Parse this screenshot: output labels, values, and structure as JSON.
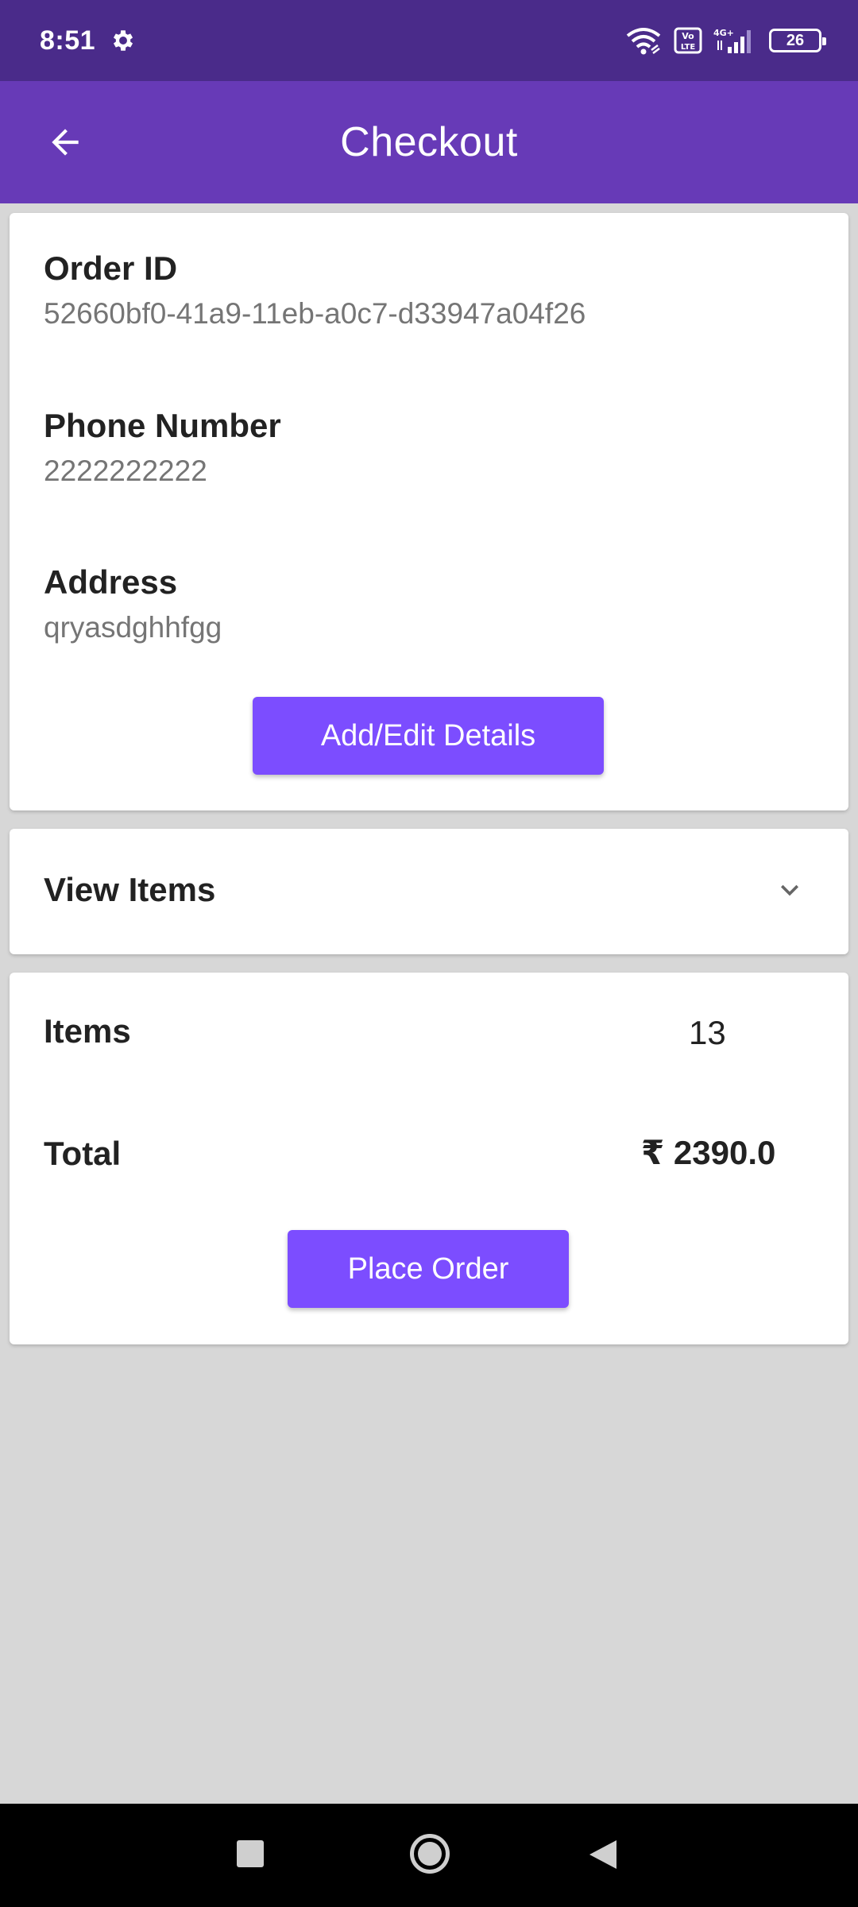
{
  "status_bar": {
    "time": "8:51",
    "battery_level": "26",
    "network_label": "4G+",
    "volte_label": "Vo LTE",
    "icons": [
      "settings-gear-icon",
      "wifi-icon",
      "volte-icon",
      "signal-icon",
      "battery-icon"
    ]
  },
  "app_bar": {
    "title": "Checkout",
    "back_icon": "arrow-back-icon",
    "color": "#673ab7"
  },
  "details": {
    "order_id_label": "Order ID",
    "order_id_value": "52660bf0-41a9-11eb-a0c7-d33947a04f26",
    "phone_label": "Phone Number",
    "phone_value": "2222222222",
    "address_label": "Address",
    "address_value": "qryasdghhfgg",
    "edit_button_label": "Add/Edit Details"
  },
  "view_items": {
    "label": "View Items",
    "expand_icon": "chevron-down-icon"
  },
  "summary": {
    "items_label": "Items",
    "items_value": "13",
    "total_label": "Total",
    "total_value": "₹ 2390.0",
    "place_order_label": "Place Order"
  },
  "nav_bar": {
    "icons": [
      "recents-square-icon",
      "home-circle-icon",
      "back-triangle-icon"
    ]
  },
  "colors": {
    "status_bar": "#4a2b8a",
    "accent_button": "#7c4dff",
    "background": "#d7d7d7"
  }
}
